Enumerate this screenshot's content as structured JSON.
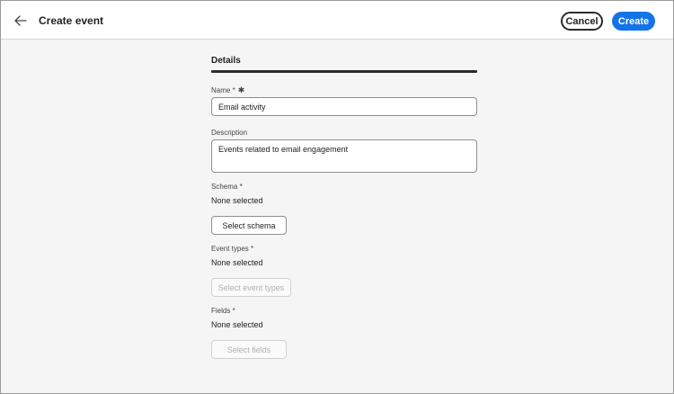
{
  "header": {
    "back_icon": "arrow-left-icon",
    "title": "Create event",
    "cancel_label": "Cancel",
    "create_label": "Create",
    "accent_color": "#1473e6"
  },
  "tabs": [
    {
      "label": "Details",
      "selected": true
    }
  ],
  "form": {
    "name": {
      "label": "Name *",
      "required_icon": "asterisk-icon",
      "value": "Email activity"
    },
    "description": {
      "label": "Description",
      "value": "Events related to email engagement"
    },
    "schema": {
      "label": "Schema *",
      "value": "None selected",
      "button_label": "Select schema",
      "button_enabled": true
    },
    "event_types": {
      "label": "Event types *",
      "value": "None selected",
      "button_label": "Select event types",
      "button_enabled": false
    },
    "fields": {
      "label": "Fields *",
      "value": "None selected",
      "button_label": "Select fields",
      "button_enabled": false
    }
  }
}
